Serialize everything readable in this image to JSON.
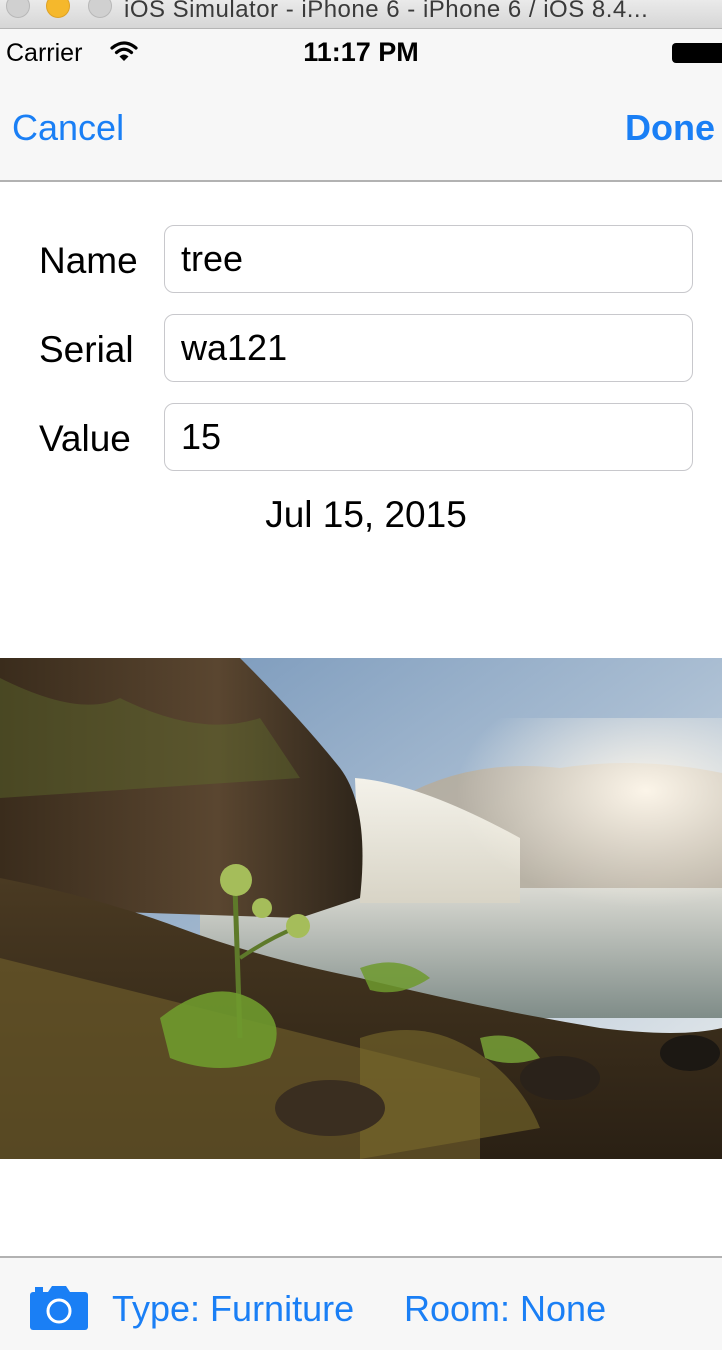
{
  "window": {
    "title": "iOS Simulator - iPhone 6 - iPhone 6 / iOS 8.4..."
  },
  "status_bar": {
    "carrier": "Carrier",
    "time": "11:17 PM",
    "wifi_icon": "wifi-icon",
    "battery_icon": "battery-icon"
  },
  "nav_bar": {
    "cancel_label": "Cancel",
    "done_label": "Done"
  },
  "form": {
    "name_label": "Name",
    "name_value": "tree",
    "serial_label": "Serial",
    "serial_value": "wa121",
    "value_label": "Value",
    "value_value": "15",
    "date": "Jul 15, 2015"
  },
  "toolbar": {
    "camera_icon": "camera-icon",
    "type_label": "Type: Furniture",
    "room_label": "Room: None"
  },
  "colors": {
    "ios_tint": "#1a7ff5",
    "bar_background": "#f7f7f7",
    "separator": "#b2b2b2"
  }
}
